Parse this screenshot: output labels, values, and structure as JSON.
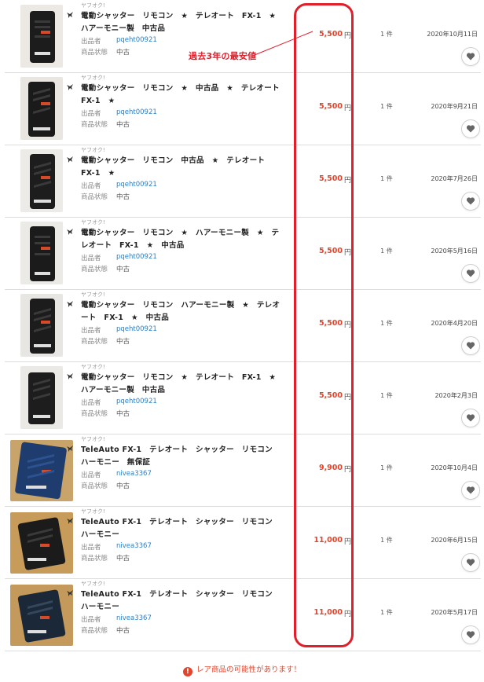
{
  "colors": {
    "price": "#e2452c",
    "highlight": "#e01f2a",
    "seller_link": "#2a7ec8"
  },
  "labels": {
    "seller": "出品者",
    "condition": "商品状態",
    "yen": "円"
  },
  "annotation": {
    "text": "過去3年の最安値"
  },
  "notice": {
    "icon": "exclamation-icon",
    "text": "レア商品の可能性があります！"
  },
  "items": [
    {
      "source": "ヤフオク!",
      "title": "電動シャッター　リモコン　★　テレオート　FX-1　★　ハアーモニー製　中古品",
      "seller": "pqeht00921",
      "condition": "中古",
      "price": "5,500",
      "qty": "1 件",
      "date": "2020年10月11日"
    },
    {
      "source": "ヤフオク!",
      "title": "電動シャッター　リモコン　★　中古品　★　テレオート　FX-1　★",
      "seller": "pqeht00921",
      "condition": "中古",
      "price": "5,500",
      "qty": "1 件",
      "date": "2020年9月21日"
    },
    {
      "source": "ヤフオク!",
      "title": "電動シャッター　リモコン　中古品　★　テレオート　FX-1　★",
      "seller": "pqeht00921",
      "condition": "中古",
      "price": "5,500",
      "qty": "1 件",
      "date": "2020年7月26日"
    },
    {
      "source": "ヤフオク!",
      "title": "電動シャッター　リモコン　★　ハアーモニー製　★　テレオート　FX-1　★　中古品",
      "seller": "pqeht00921",
      "condition": "中古",
      "price": "5,500",
      "qty": "1 件",
      "date": "2020年5月16日"
    },
    {
      "source": "ヤフオク!",
      "title": "電動シャッター　リモコン　ハアーモニー製　★　テレオート　FX-1　★　中古品",
      "seller": "pqeht00921",
      "condition": "中古",
      "price": "5,500",
      "qty": "1 件",
      "date": "2020年4月20日"
    },
    {
      "source": "ヤフオク!",
      "title": "電動シャッター　リモコン　★　テレオート　FX-1　★　ハアーモニー製　中古品",
      "seller": "pqeht00921",
      "condition": "中古",
      "price": "5,500",
      "qty": "1 件",
      "date": "2020年2月3日"
    },
    {
      "source": "ヤフオク!",
      "title": "TeleAuto FX-1　テレオート　シャッター　リモコン　ハーモニー　無保証",
      "seller": "nivea3367",
      "condition": "中古",
      "price": "9,900",
      "qty": "1 件",
      "date": "2020年10月4日"
    },
    {
      "source": "ヤフオク!",
      "title": "TeleAuto FX-1　テレオート　シャッター　リモコン　ハーモニー",
      "seller": "nivea3367",
      "condition": "中古",
      "price": "11,000",
      "qty": "1 件",
      "date": "2020年6月15日"
    },
    {
      "source": "ヤフオク!",
      "title": "TeleAuto FX-1　テレオート　シャッター　リモコン　ハーモニー",
      "seller": "nivea3367",
      "condition": "中古",
      "price": "11,000",
      "qty": "1 件",
      "date": "2020年5月17日"
    }
  ]
}
